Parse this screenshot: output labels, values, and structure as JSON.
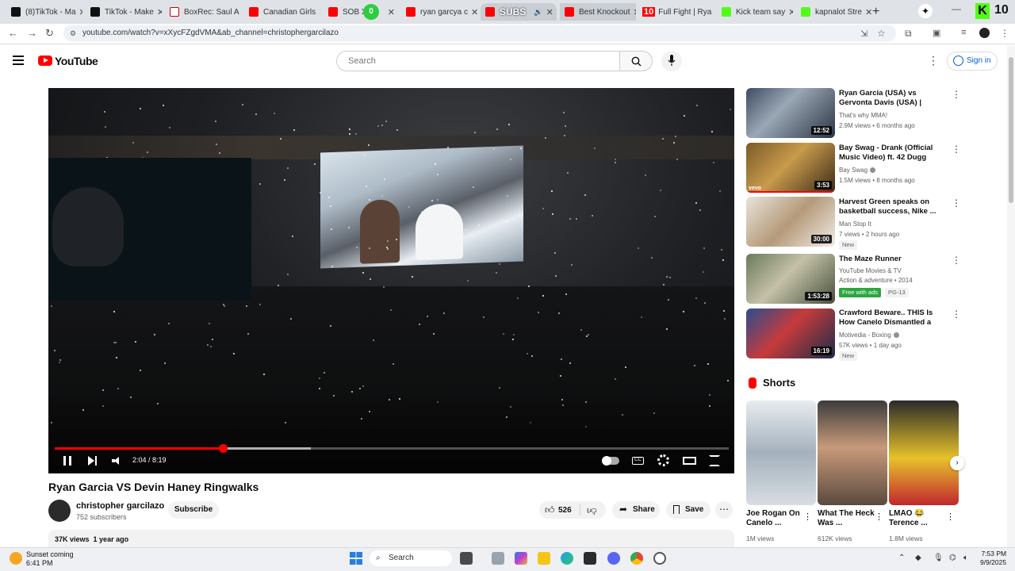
{
  "browser": {
    "tabs": [
      {
        "title": "(8)TikTok - Ma",
        "favicon": "tiktok-icon"
      },
      {
        "title": "TikTok - Make",
        "favicon": "tiktok-icon"
      },
      {
        "title": "BoxRec: Saul A",
        "favicon": "boxrec-icon"
      },
      {
        "title": "Canadian Girls",
        "favicon": "youtube-icon"
      },
      {
        "title": "SOB X R",
        "favicon": "youtube-icon"
      },
      {
        "title": "ryan garcya c",
        "favicon": "youtube-icon"
      },
      {
        "title": "SUBS",
        "favicon": "youtube-icon"
      },
      {
        "title": "Best Knockout",
        "favicon": "youtube-icon"
      },
      {
        "title": "Full Fight | Rya",
        "favicon": "youtube-icon"
      },
      {
        "title": "Kick team say",
        "favicon": "kick-icon"
      },
      {
        "title": "kapnalot Stre",
        "favicon": "kick-icon"
      }
    ],
    "tab_badge_zero": "0",
    "tab_badge_ten": "10",
    "corner_badge": "10",
    "corner_k": "K",
    "url": "youtube.com/watch?v=xXycFZgdVMA&ab_channel=christophergarcilazo"
  },
  "youtube": {
    "wordmark": "YouTube",
    "search_placeholder": "Search",
    "sign_in": "Sign in"
  },
  "player": {
    "current_time": "2:04",
    "duration": "8:19",
    "time_display": "2:04 / 8:19",
    "progress_fraction": 0.249,
    "buffered_fraction": 0.38,
    "accent": "#ff0000"
  },
  "video": {
    "title": "Ryan Garcia VS Devin Haney Ringwalks",
    "channel": "christopher garcilazo",
    "subscribers": "752 subscribers",
    "subscribe_label": "Subscribe",
    "likes": "526",
    "share_label": "Share",
    "save_label": "Save",
    "views": "37K views",
    "date": "1 year ago"
  },
  "recommendations": [
    {
      "title": "Ryan Garcia (USA) vs Gervonta Davis (USA) | KNOCKOUT, ...",
      "channel": "That's why MMA!",
      "meta": "2.9M views • 6 months ago",
      "duration": "12:52",
      "verified": false,
      "badges": []
    },
    {
      "title": "Bay Swag - Drank (Official Music Video) ft. 42 Dugg",
      "channel": "Bay Swag",
      "meta": "1.5M views • 8 months ago",
      "duration": "3:53",
      "verified": true,
      "badges": []
    },
    {
      "title": "Harvest Green speaks on basketball success, Nike ...",
      "channel": "Man Stop It",
      "meta": "7 views • 2 hours ago",
      "duration": "30:00",
      "verified": false,
      "badges": [
        "New"
      ]
    },
    {
      "title": "The Maze Runner",
      "channel": "YouTube Movies & TV",
      "meta": "Action & adventure • 2014",
      "duration": "1:53:28",
      "verified": false,
      "badges": [
        "Free with ads",
        "PG-13"
      ]
    },
    {
      "title": "Crawford Beware.. THIS Is How Canelo Dismantled a Future H...",
      "channel": "Motivedia - Boxing",
      "meta": "57K views • 1 day ago",
      "duration": "16:19",
      "verified": true,
      "badges": [
        "New"
      ]
    }
  ],
  "shorts": {
    "heading": "Shorts",
    "items": [
      {
        "title": "Joe Rogan On Canelo ...",
        "views": "1M views"
      },
      {
        "title": "What The Heck Was ...",
        "views": "612K views"
      },
      {
        "title": "LMAO 😂 Terence ...",
        "views": "1.8M views"
      }
    ]
  },
  "taskbar": {
    "weather_title": "Sunset coming",
    "weather_time": "6:41 PM",
    "search_label": "Search",
    "time": "7:53 PM",
    "date": "9/9/2025"
  }
}
